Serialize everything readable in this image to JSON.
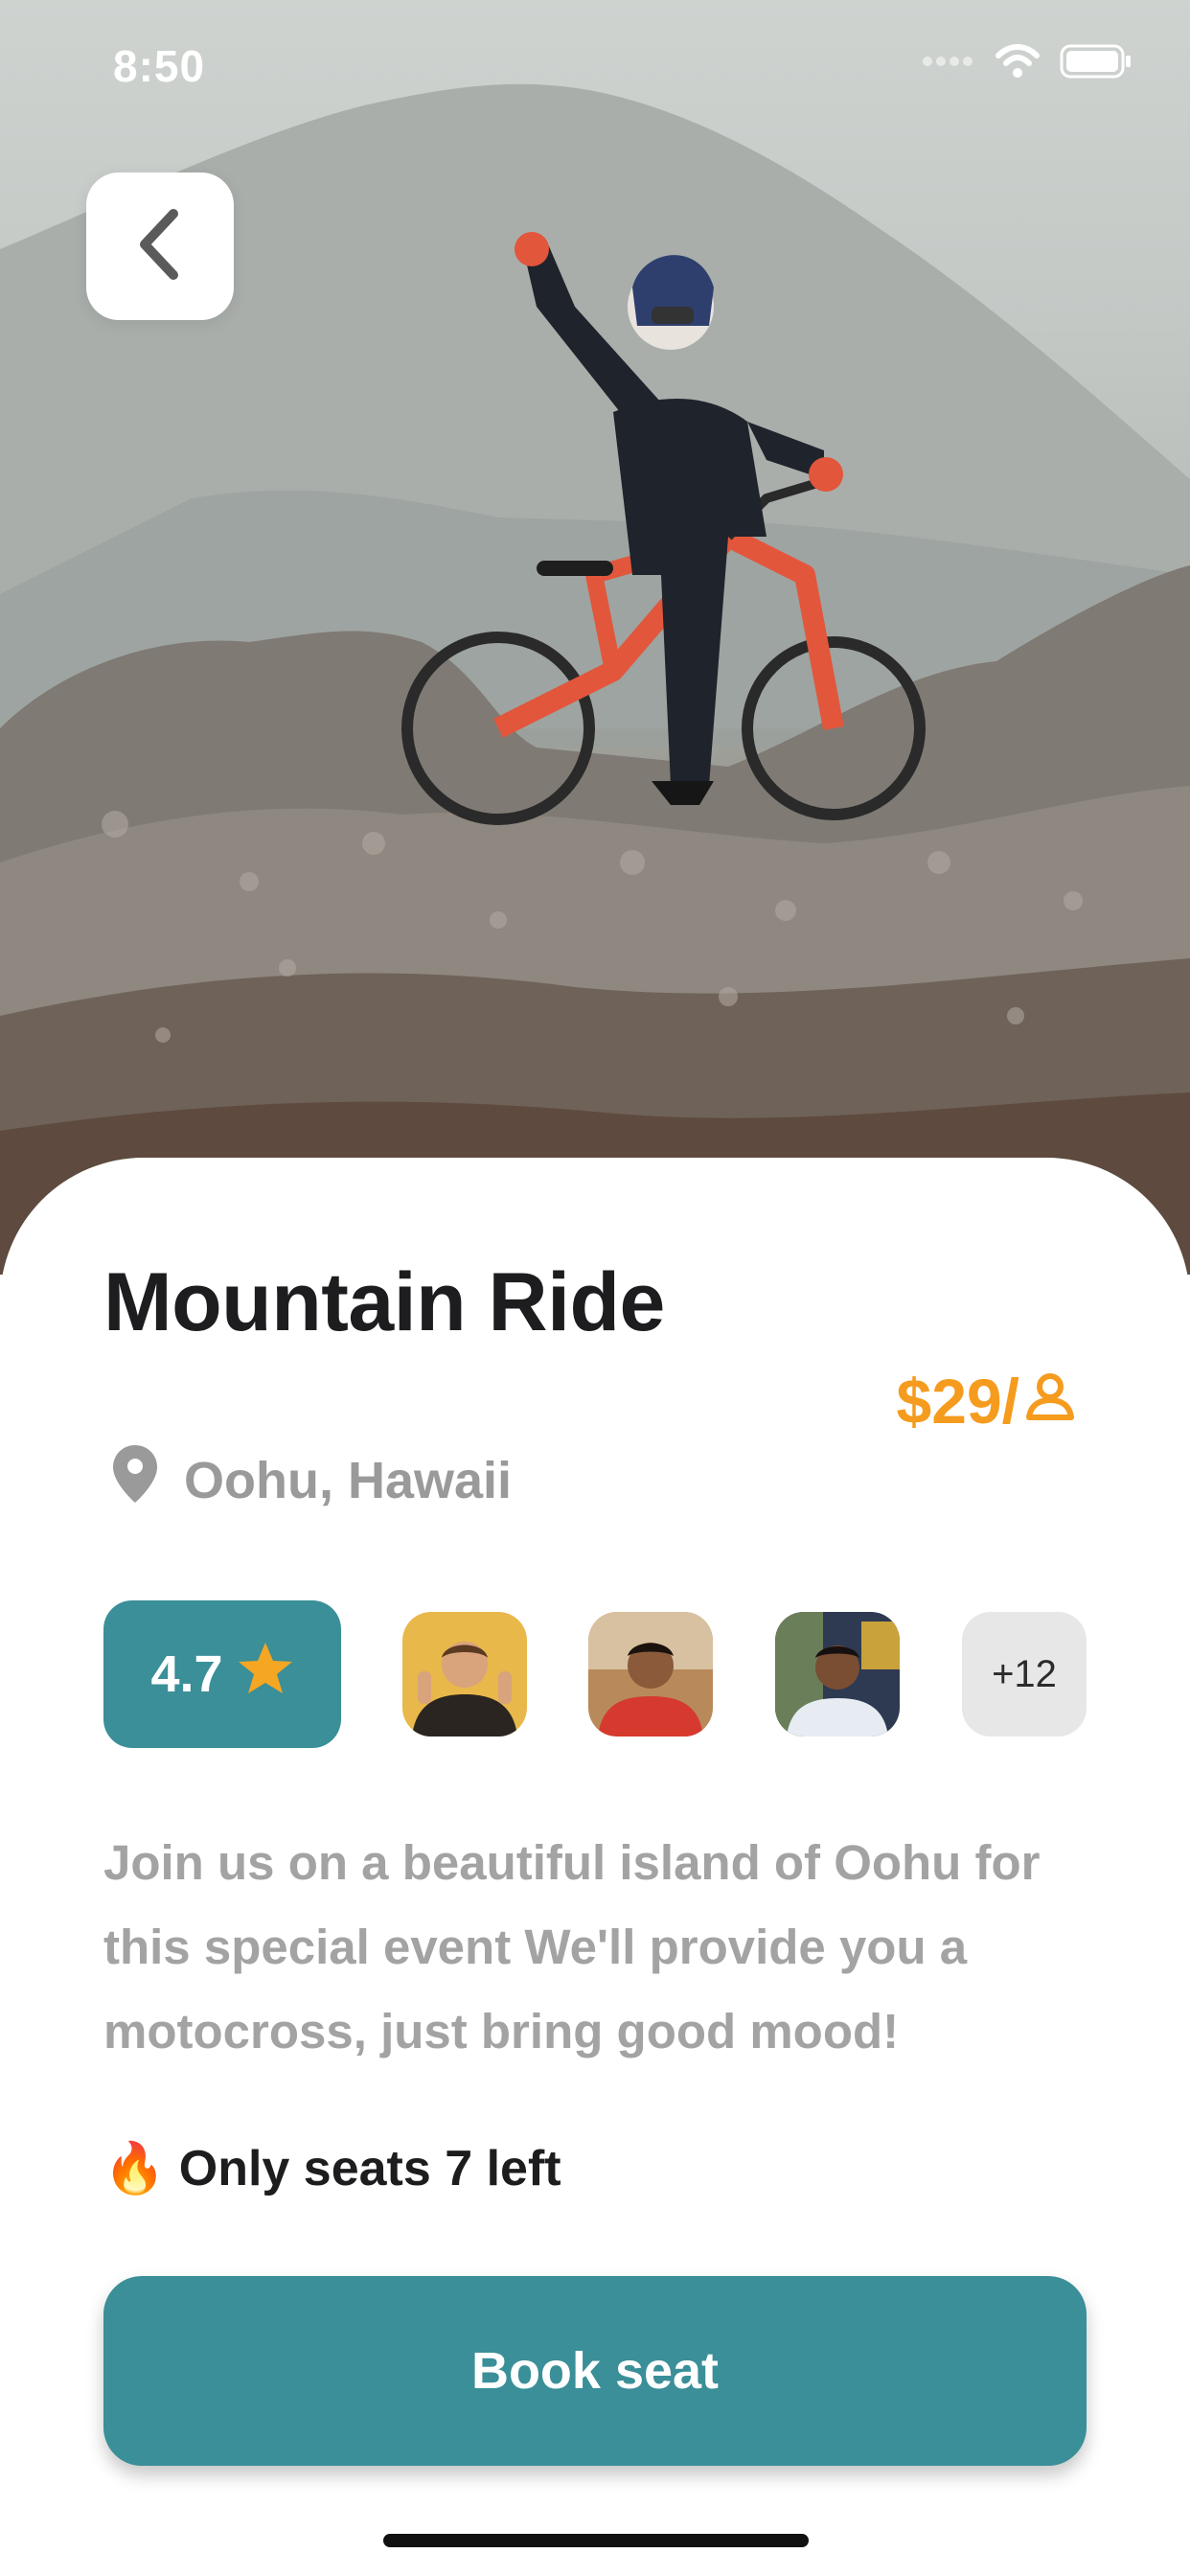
{
  "status_bar": {
    "time": "8:50"
  },
  "event": {
    "title": "Mountain Ride",
    "price": "$29/",
    "location": "Oohu, Hawaii",
    "rating": "4.7",
    "attendees_more": "+12",
    "description": "Join us on a beautiful island of Oohu for this special event We'll provide you a motocross, just bring good mood!",
    "seats_text": "Only seats 7 left",
    "seats_emoji": "🔥"
  },
  "actions": {
    "book_label": "Book seat"
  },
  "icons": {
    "back": "chevron-left-icon",
    "location": "map-pin-icon",
    "per_person": "person-icon",
    "rating": "star-icon"
  },
  "colors": {
    "accent": "#3a8f98",
    "price": "#f59b1e",
    "star": "#f5a623"
  }
}
